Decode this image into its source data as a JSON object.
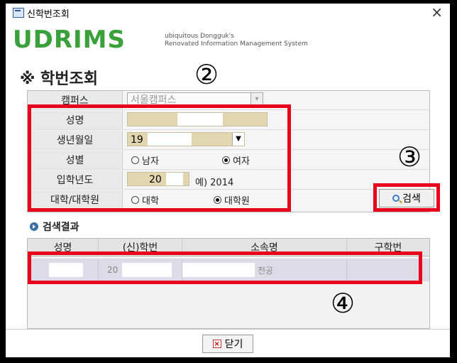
{
  "window": {
    "title": "신학번조회",
    "close": "×"
  },
  "logo": {
    "brand": "UDRIMS",
    "tagline1": "ubiquitous Dongguk's",
    "tagline2": "Renovated Information Management System"
  },
  "heading": "※ 학번조회",
  "form": {
    "campus_label": "캠퍼스",
    "campus_value": "서울캠퍼스",
    "name_label": "성명",
    "birth_label": "생년월일",
    "birth_value": "19",
    "gender_label": "성별",
    "gender_male": "남자",
    "gender_female": "여자",
    "gender_selected": "여자",
    "year_label": "입학년도",
    "year_value": "20",
    "year_hint": "예) 2014",
    "level_label": "대학/대학원",
    "level_undergrad": "대학",
    "level_grad": "대학원",
    "level_selected": "대학원"
  },
  "search_button": "검색",
  "results": {
    "title": "검색결과",
    "columns": [
      "성명",
      "(신)학번",
      "소속명",
      "구학번"
    ],
    "rows": [
      {
        "name": "",
        "student_id": "20",
        "department": "전공",
        "old_id": ""
      }
    ]
  },
  "close_button": "닫기",
  "annotations": {
    "n2": "②",
    "n3": "③",
    "n4": "④"
  },
  "colors": {
    "annotation_red": "#e8001c",
    "field_tan": "#e2d6b0",
    "logo_green": "#3aa03a"
  }
}
